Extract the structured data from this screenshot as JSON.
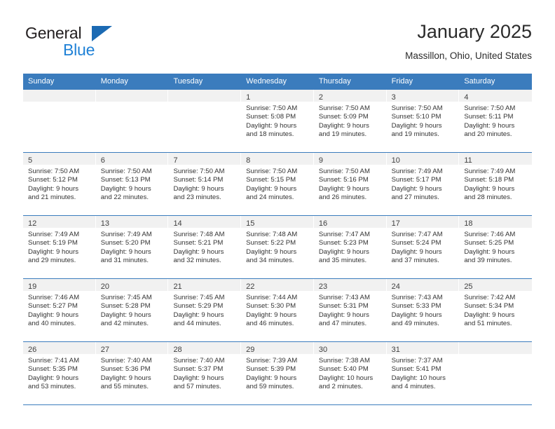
{
  "brand": {
    "name_top": "General",
    "name_bottom": "Blue",
    "triangle_color": "#1b6ab3",
    "blue_text_color": "#1f81d6"
  },
  "header": {
    "title": "January 2025",
    "subtitle": "Massillon, Ohio, United States"
  },
  "theme": {
    "header_blue": "#3b7cbd",
    "daystrip_gray": "#f1f1f1",
    "row_divider": "#3b7cbd"
  },
  "weekdays": [
    "Sunday",
    "Monday",
    "Tuesday",
    "Wednesday",
    "Thursday",
    "Friday",
    "Saturday"
  ],
  "weeks": [
    [
      {
        "day": "",
        "lines": []
      },
      {
        "day": "",
        "lines": []
      },
      {
        "day": "",
        "lines": []
      },
      {
        "day": "1",
        "lines": [
          "Sunrise: 7:50 AM",
          "Sunset: 5:08 PM",
          "Daylight: 9 hours",
          "and 18 minutes."
        ]
      },
      {
        "day": "2",
        "lines": [
          "Sunrise: 7:50 AM",
          "Sunset: 5:09 PM",
          "Daylight: 9 hours",
          "and 19 minutes."
        ]
      },
      {
        "day": "3",
        "lines": [
          "Sunrise: 7:50 AM",
          "Sunset: 5:10 PM",
          "Daylight: 9 hours",
          "and 19 minutes."
        ]
      },
      {
        "day": "4",
        "lines": [
          "Sunrise: 7:50 AM",
          "Sunset: 5:11 PM",
          "Daylight: 9 hours",
          "and 20 minutes."
        ]
      }
    ],
    [
      {
        "day": "5",
        "lines": [
          "Sunrise: 7:50 AM",
          "Sunset: 5:12 PM",
          "Daylight: 9 hours",
          "and 21 minutes."
        ]
      },
      {
        "day": "6",
        "lines": [
          "Sunrise: 7:50 AM",
          "Sunset: 5:13 PM",
          "Daylight: 9 hours",
          "and 22 minutes."
        ]
      },
      {
        "day": "7",
        "lines": [
          "Sunrise: 7:50 AM",
          "Sunset: 5:14 PM",
          "Daylight: 9 hours",
          "and 23 minutes."
        ]
      },
      {
        "day": "8",
        "lines": [
          "Sunrise: 7:50 AM",
          "Sunset: 5:15 PM",
          "Daylight: 9 hours",
          "and 24 minutes."
        ]
      },
      {
        "day": "9",
        "lines": [
          "Sunrise: 7:50 AM",
          "Sunset: 5:16 PM",
          "Daylight: 9 hours",
          "and 26 minutes."
        ]
      },
      {
        "day": "10",
        "lines": [
          "Sunrise: 7:49 AM",
          "Sunset: 5:17 PM",
          "Daylight: 9 hours",
          "and 27 minutes."
        ]
      },
      {
        "day": "11",
        "lines": [
          "Sunrise: 7:49 AM",
          "Sunset: 5:18 PM",
          "Daylight: 9 hours",
          "and 28 minutes."
        ]
      }
    ],
    [
      {
        "day": "12",
        "lines": [
          "Sunrise: 7:49 AM",
          "Sunset: 5:19 PM",
          "Daylight: 9 hours",
          "and 29 minutes."
        ]
      },
      {
        "day": "13",
        "lines": [
          "Sunrise: 7:49 AM",
          "Sunset: 5:20 PM",
          "Daylight: 9 hours",
          "and 31 minutes."
        ]
      },
      {
        "day": "14",
        "lines": [
          "Sunrise: 7:48 AM",
          "Sunset: 5:21 PM",
          "Daylight: 9 hours",
          "and 32 minutes."
        ]
      },
      {
        "day": "15",
        "lines": [
          "Sunrise: 7:48 AM",
          "Sunset: 5:22 PM",
          "Daylight: 9 hours",
          "and 34 minutes."
        ]
      },
      {
        "day": "16",
        "lines": [
          "Sunrise: 7:47 AM",
          "Sunset: 5:23 PM",
          "Daylight: 9 hours",
          "and 35 minutes."
        ]
      },
      {
        "day": "17",
        "lines": [
          "Sunrise: 7:47 AM",
          "Sunset: 5:24 PM",
          "Daylight: 9 hours",
          "and 37 minutes."
        ]
      },
      {
        "day": "18",
        "lines": [
          "Sunrise: 7:46 AM",
          "Sunset: 5:25 PM",
          "Daylight: 9 hours",
          "and 39 minutes."
        ]
      }
    ],
    [
      {
        "day": "19",
        "lines": [
          "Sunrise: 7:46 AM",
          "Sunset: 5:27 PM",
          "Daylight: 9 hours",
          "and 40 minutes."
        ]
      },
      {
        "day": "20",
        "lines": [
          "Sunrise: 7:45 AM",
          "Sunset: 5:28 PM",
          "Daylight: 9 hours",
          "and 42 minutes."
        ]
      },
      {
        "day": "21",
        "lines": [
          "Sunrise: 7:45 AM",
          "Sunset: 5:29 PM",
          "Daylight: 9 hours",
          "and 44 minutes."
        ]
      },
      {
        "day": "22",
        "lines": [
          "Sunrise: 7:44 AM",
          "Sunset: 5:30 PM",
          "Daylight: 9 hours",
          "and 46 minutes."
        ]
      },
      {
        "day": "23",
        "lines": [
          "Sunrise: 7:43 AM",
          "Sunset: 5:31 PM",
          "Daylight: 9 hours",
          "and 47 minutes."
        ]
      },
      {
        "day": "24",
        "lines": [
          "Sunrise: 7:43 AM",
          "Sunset: 5:33 PM",
          "Daylight: 9 hours",
          "and 49 minutes."
        ]
      },
      {
        "day": "25",
        "lines": [
          "Sunrise: 7:42 AM",
          "Sunset: 5:34 PM",
          "Daylight: 9 hours",
          "and 51 minutes."
        ]
      }
    ],
    [
      {
        "day": "26",
        "lines": [
          "Sunrise: 7:41 AM",
          "Sunset: 5:35 PM",
          "Daylight: 9 hours",
          "and 53 minutes."
        ]
      },
      {
        "day": "27",
        "lines": [
          "Sunrise: 7:40 AM",
          "Sunset: 5:36 PM",
          "Daylight: 9 hours",
          "and 55 minutes."
        ]
      },
      {
        "day": "28",
        "lines": [
          "Sunrise: 7:40 AM",
          "Sunset: 5:37 PM",
          "Daylight: 9 hours",
          "and 57 minutes."
        ]
      },
      {
        "day": "29",
        "lines": [
          "Sunrise: 7:39 AM",
          "Sunset: 5:39 PM",
          "Daylight: 9 hours",
          "and 59 minutes."
        ]
      },
      {
        "day": "30",
        "lines": [
          "Sunrise: 7:38 AM",
          "Sunset: 5:40 PM",
          "Daylight: 10 hours",
          "and 2 minutes."
        ]
      },
      {
        "day": "31",
        "lines": [
          "Sunrise: 7:37 AM",
          "Sunset: 5:41 PM",
          "Daylight: 10 hours",
          "and 4 minutes."
        ]
      },
      {
        "day": "",
        "lines": []
      }
    ]
  ]
}
